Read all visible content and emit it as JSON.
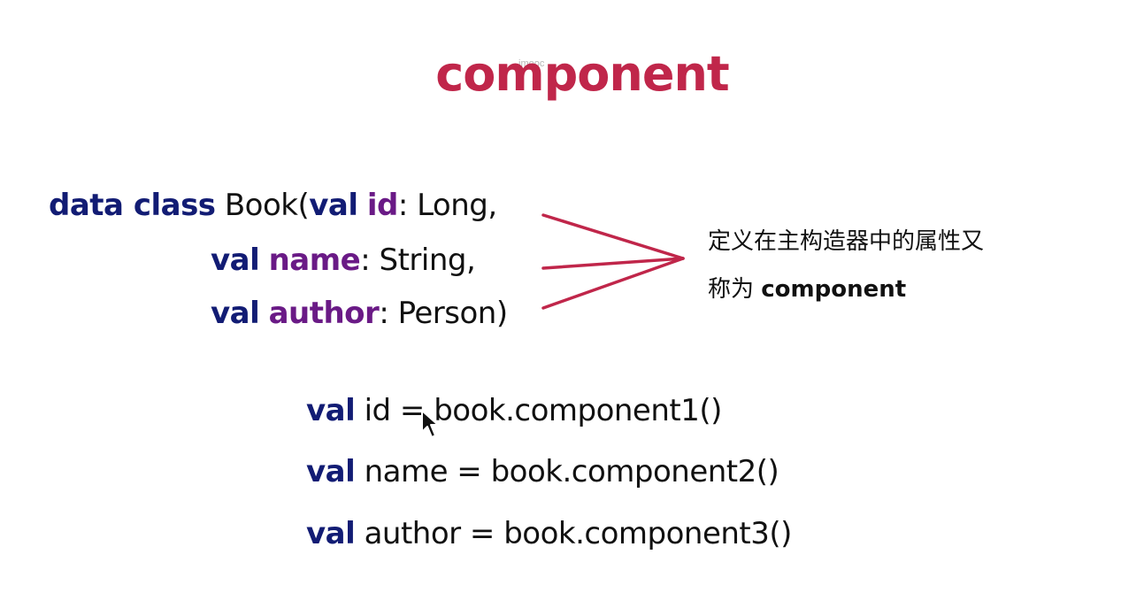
{
  "slide": {
    "watermark": "imooc",
    "title": "component",
    "declaration": {
      "line1": {
        "kw1": "data class",
        "text1": " Book(",
        "kw2": "val",
        "prop": "id",
        "text2": ": Long,"
      },
      "line2": {
        "kw": "val",
        "prop": "name",
        "text": ": String,"
      },
      "line3": {
        "kw": "val",
        "prop": "author",
        "text": ": Person)"
      }
    },
    "note": {
      "line1": "定义在主构造器中的属性又",
      "line2_prefix": "称为 ",
      "line2_bold": "component"
    },
    "destructuring": [
      {
        "kw": "val",
        "text": " id = book.component1()"
      },
      {
        "kw": "val",
        "text": " name = book.component2()"
      },
      {
        "kw": "val",
        "text": " author = book.component3()"
      }
    ],
    "colors": {
      "title": "#c0264a",
      "keyword": "#121c74",
      "property": "#6a1a86",
      "arrow": "#c0264a"
    },
    "icons": {
      "cursor": "mouse-pointer-icon"
    }
  }
}
